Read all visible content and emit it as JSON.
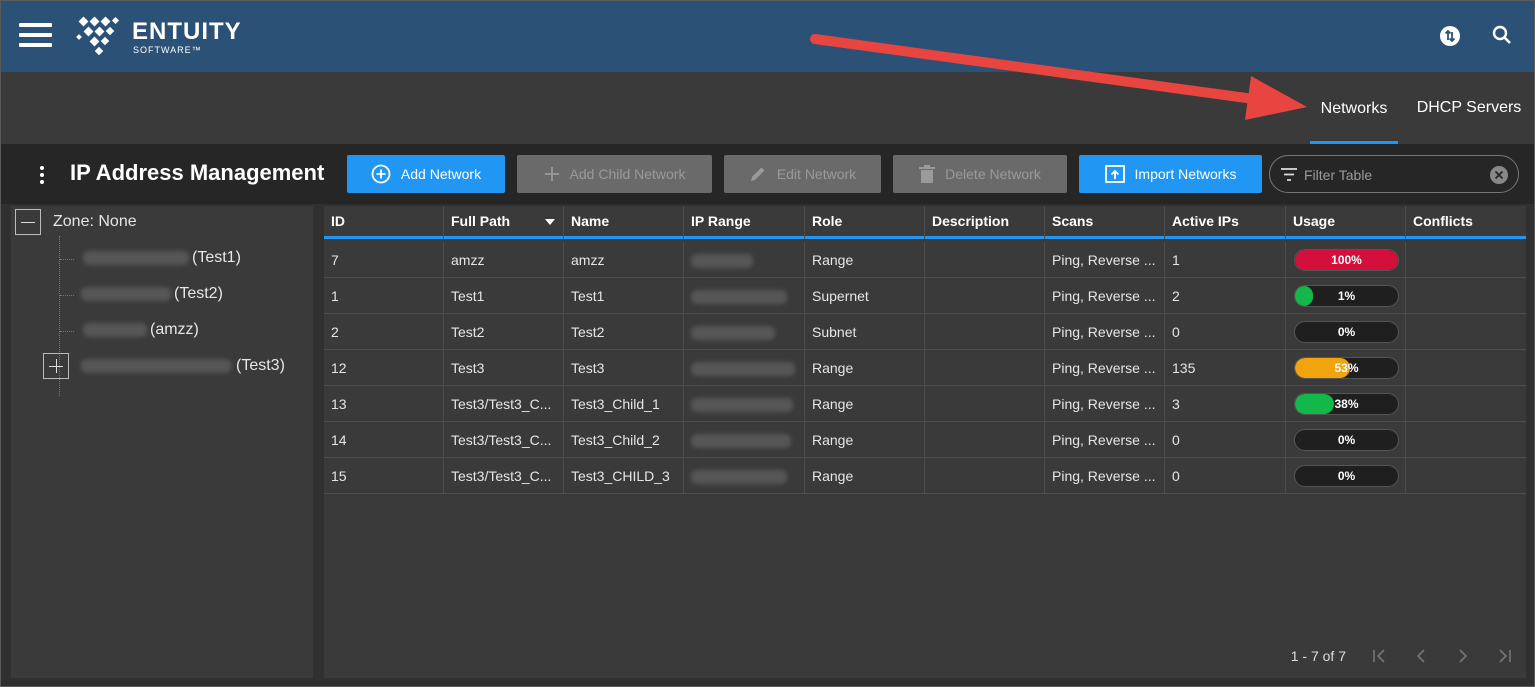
{
  "app": {
    "logo_word": "ENTUITY",
    "logo_sub": "SOFTWARE™"
  },
  "tabs": [
    {
      "label": "Networks",
      "active": true
    },
    {
      "label": "DHCP Servers",
      "active": false
    }
  ],
  "toolbar": {
    "title": "IP Address Management",
    "buttons": [
      {
        "label": "Add Network",
        "enabled": true,
        "icon": "plus-circle-icon"
      },
      {
        "label": "Add Child Network",
        "enabled": false,
        "icon": "plus-icon"
      },
      {
        "label": "Edit Network",
        "enabled": false,
        "icon": "pencil-icon"
      },
      {
        "label": "Delete Network",
        "enabled": false,
        "icon": "trash-icon"
      },
      {
        "label": "Import Networks",
        "enabled": true,
        "icon": "import-icon"
      }
    ],
    "filter_placeholder": "Filter Table"
  },
  "tree": {
    "root_label": "Zone: None",
    "items": [
      {
        "suffix": "(Test1)"
      },
      {
        "suffix": "(Test2)"
      },
      {
        "suffix": "(amzz)"
      },
      {
        "suffix": "(Test3)"
      }
    ]
  },
  "grid": {
    "columns": [
      "ID",
      "Full Path",
      "Name",
      "IP Range",
      "Role",
      "Description",
      "Scans",
      "Active IPs",
      "Usage",
      "Conflicts"
    ],
    "rows": [
      {
        "id": "7",
        "full_path": "amzz",
        "name": "amzz",
        "role": "Range",
        "description": "",
        "scans": "Ping, Reverse ...",
        "active_ips": "1",
        "usage_pct": 100,
        "usage_label": "100%",
        "conflicts": ""
      },
      {
        "id": "1",
        "full_path": "Test1",
        "name": "Test1",
        "role": "Supernet",
        "description": "",
        "scans": "Ping, Reverse ...",
        "active_ips": "2",
        "usage_pct": 1,
        "usage_label": "1%",
        "conflicts": ""
      },
      {
        "id": "2",
        "full_path": "Test2",
        "name": "Test2",
        "role": "Subnet",
        "description": "",
        "scans": "Ping, Reverse ...",
        "active_ips": "0",
        "usage_pct": 0,
        "usage_label": "0%",
        "conflicts": ""
      },
      {
        "id": "12",
        "full_path": "Test3",
        "name": "Test3",
        "role": "Range",
        "description": "",
        "scans": "Ping, Reverse ...",
        "active_ips": "135",
        "usage_pct": 53,
        "usage_label": "53%",
        "conflicts": ""
      },
      {
        "id": "13",
        "full_path": "Test3/Test3_C...",
        "name": "Test3_Child_1",
        "role": "Range",
        "description": "",
        "scans": "Ping, Reverse ...",
        "active_ips": "3",
        "usage_pct": 38,
        "usage_label": "38%",
        "conflicts": ""
      },
      {
        "id": "14",
        "full_path": "Test3/Test3_C...",
        "name": "Test3_Child_2",
        "role": "Range",
        "description": "",
        "scans": "Ping, Reverse ...",
        "active_ips": "0",
        "usage_pct": 0,
        "usage_label": "0%",
        "conflicts": ""
      },
      {
        "id": "15",
        "full_path": "Test3/Test3_C...",
        "name": "Test3_CHILD_3",
        "role": "Range",
        "description": "",
        "scans": "Ping, Reverse ...",
        "active_ips": "0",
        "usage_pct": 0,
        "usage_label": "0%",
        "conflicts": ""
      }
    ],
    "pagination": "1 - 7 of 7"
  },
  "colors": {
    "header_bg": "#2b5177",
    "accent": "#2196f3",
    "usage_red": "#d50f3b",
    "usage_green": "#14b84a",
    "usage_orange": "#f2a40f",
    "annotation_arrow": "#e84440"
  }
}
